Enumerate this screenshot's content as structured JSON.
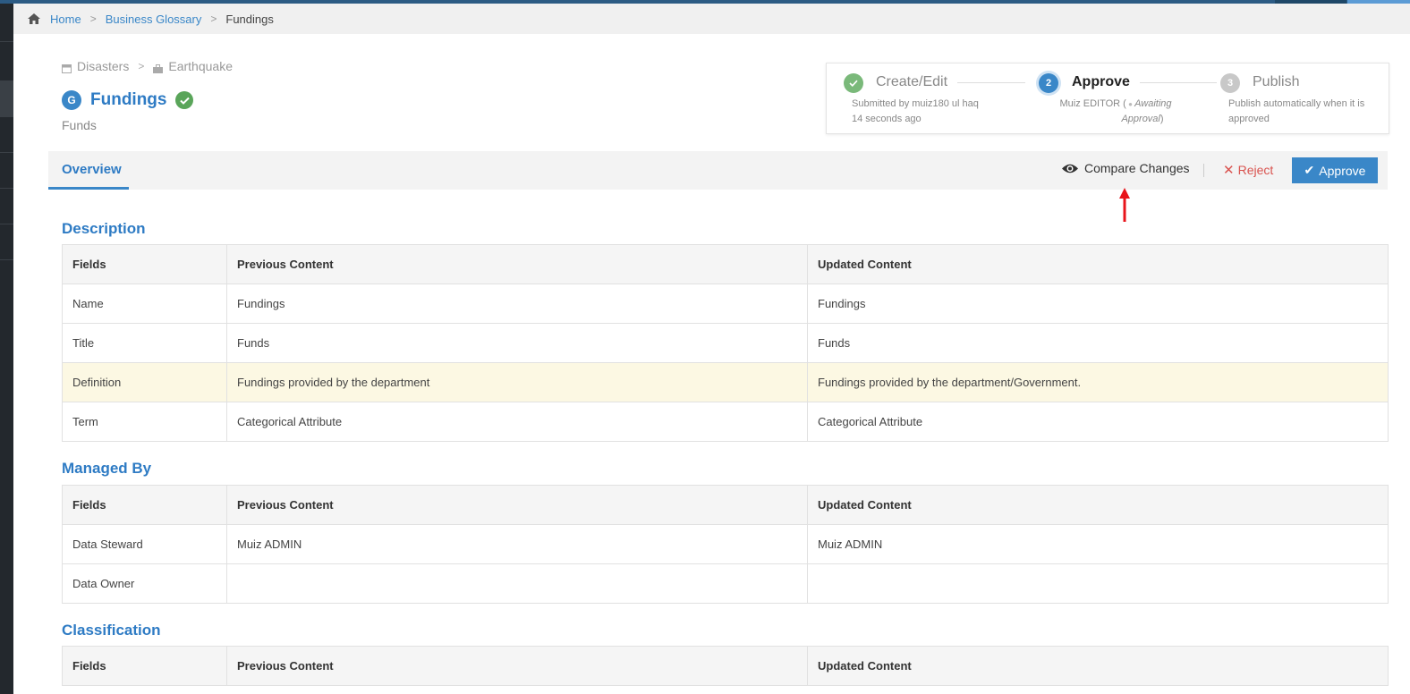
{
  "breadcrumb": {
    "home": "Home",
    "glossary": "Business Glossary",
    "current": "Fundings",
    "sep": ">"
  },
  "path": {
    "parent": "Disasters",
    "child": "Earthquake",
    "sep": ">"
  },
  "term": {
    "badge": "G",
    "title": "Fundings",
    "subtitle": "Funds"
  },
  "workflow": {
    "steps": [
      {
        "label": "Create/Edit",
        "number": "",
        "desc1": "Submitted by muiz180 ul haq",
        "desc2": "14 seconds ago",
        "state": "done"
      },
      {
        "label": "Approve",
        "number": "2",
        "desc1": "Muiz EDITOR (",
        "desc1b": "Awaiting",
        "desc2": "Approval",
        "desc2b": ")",
        "state": "active"
      },
      {
        "label": "Publish",
        "number": "3",
        "desc1": "Publish automatically when it is",
        "desc2": "approved",
        "state": "pending"
      }
    ]
  },
  "tabs": {
    "overview": "Overview"
  },
  "actions": {
    "compare": "Compare Changes",
    "reject": "Reject",
    "approve": "Approve",
    "reject_icon": "✕",
    "approve_icon": "✔"
  },
  "headers": {
    "fields": "Fields",
    "previous": "Previous Content",
    "updated": "Updated Content"
  },
  "sections": {
    "description": {
      "title": "Description",
      "rows": [
        {
          "field": "Name",
          "previous": "Fundings",
          "updated": "Fundings"
        },
        {
          "field": "Title",
          "previous": "Funds",
          "updated": "Funds"
        },
        {
          "field": "Definition",
          "previous": "Fundings provided by the department",
          "updated": "Fundings provided by the department/Government."
        },
        {
          "field": "Term",
          "previous": "Categorical Attribute",
          "updated": "Categorical Attribute"
        }
      ]
    },
    "managed_by": {
      "title": "Managed By",
      "rows": [
        {
          "field": "Data Steward",
          "previous": "Muiz ADMIN",
          "updated": "Muiz ADMIN"
        },
        {
          "field": "Data Owner",
          "previous": "",
          "updated": ""
        }
      ]
    },
    "classification": {
      "title": "Classification"
    }
  },
  "colors": {
    "accent": "#3a87c8",
    "success": "#5aa55a",
    "danger": "#d9534f",
    "changed_row": "#fcf8e3"
  }
}
